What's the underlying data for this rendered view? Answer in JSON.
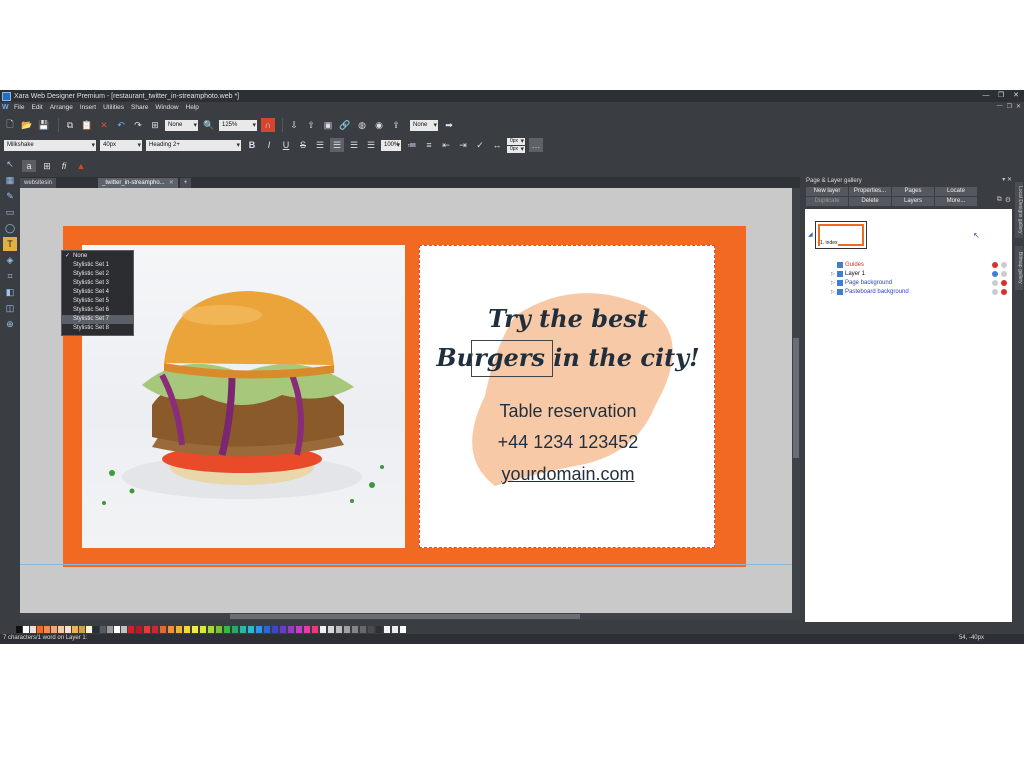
{
  "window": {
    "title": "Xara Web Designer Premium - [restaurant_twitter_in-streamphoto.web *]"
  },
  "menu": [
    "File",
    "Edit",
    "Arrange",
    "Insert",
    "Utilities",
    "Share",
    "Window",
    "Help"
  ],
  "toolbar1": {
    "quality_value": "None",
    "zoom_value": "125%",
    "opacity_value": "None"
  },
  "toolbar2": {
    "font_family": "Milkshake",
    "font_size": "40px",
    "paragraph_style": "Heading 2+",
    "bold": "B",
    "italic": "I",
    "underline": "U",
    "strike": "S",
    "line_spacing": "100%",
    "space_above": "0px",
    "space_below": "0px"
  },
  "tabs": [
    {
      "label": "websitesin",
      "active": false
    },
    {
      "label": "_twitter_in-streampho...",
      "active": true
    }
  ],
  "stylistic_sets": {
    "options": [
      "None",
      "Stylistic Set 1",
      "Stylistic Set 2",
      "Stylistic Set 3",
      "Stylistic Set 4",
      "Stylistic Set 5",
      "Stylistic Set 6",
      "Stylistic Set 7",
      "Stylistic Set 8"
    ],
    "checked": "None",
    "highlighted": "Stylistic Set 7"
  },
  "design": {
    "headline_line1": "Try the best",
    "headline_line2_word": "Burgers",
    "headline_line2_rest": " in the city!",
    "line1": "Table reservation",
    "line2": "+44 1234 123452",
    "line3": "yourdomain.com",
    "colors": {
      "frame": "#f26a21",
      "blob": "#f8c9a6",
      "text": "#1f2f3d"
    }
  },
  "gallery": {
    "title": "Page & Layer gallery",
    "buttons_row1": [
      "New layer",
      "Properties...",
      "Pages",
      "Locate"
    ],
    "buttons_row2": [
      "Duplicate",
      "Delete",
      "Layers",
      "More..."
    ],
    "page_thumb_label": "1. index",
    "layers": [
      {
        "name": "Guides",
        "color": "#d83030"
      },
      {
        "name": "Layer 1",
        "color": "#111111"
      },
      {
        "name": "Page background",
        "color": "#2d3fc4"
      },
      {
        "name": "Pasteboard background",
        "color": "#2d3fc4"
      }
    ]
  },
  "side_tabs": [
    "Local Designs gallery",
    "Bitmap gallery"
  ],
  "status": {
    "left": "7 characters/1 word on Layer 1:",
    "right": "54, -40px"
  }
}
